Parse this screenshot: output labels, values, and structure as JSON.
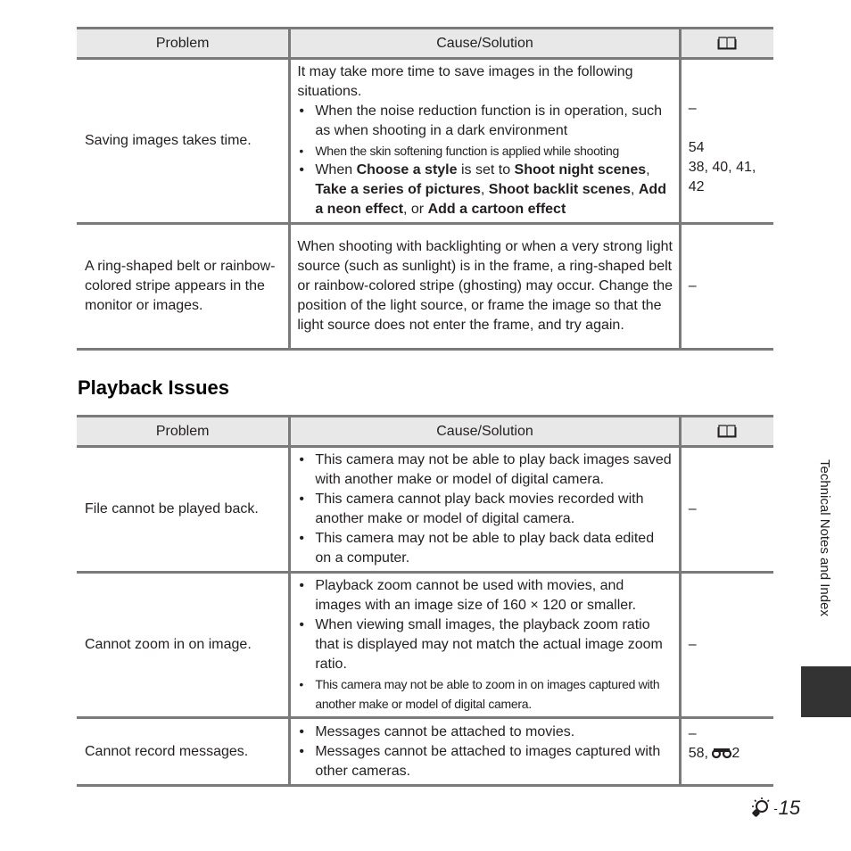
{
  "table1": {
    "headers": {
      "problem": "Problem",
      "cause": "Cause/Solution",
      "ref_icon": "book-icon"
    },
    "rows": [
      {
        "problem": "Saving images takes time.",
        "intro": "It may take more time to save images in the following situations.",
        "bullets": {
          "b1": "When the noise reduction function is in operation, such as when shooting in a dark environment",
          "b2": "When the skin softening function is applied while shooting",
          "b3": {
            "p1": "When ",
            "s1": "Choose a style",
            "p2": " is set to ",
            "s2": "Shoot night scenes",
            "p3": ", ",
            "s3": "Take a series of pictures",
            "p4": ", ",
            "s4": "Shoot backlit scenes",
            "p5": ", ",
            "s5": "Add a neon effect",
            "p6": ", or ",
            "s6": "Add a cartoon effect"
          }
        },
        "refs": {
          "r1": "–",
          "r2": "54",
          "r3": "38, 40, 41, 42"
        }
      },
      {
        "problem": "A ring-shaped belt or rainbow-colored stripe appears in the monitor or images.",
        "cause": "When shooting with backlighting or when a very strong light source (such as sunlight) is in the frame, a ring-shaped belt or rainbow-colored stripe (ghosting) may occur. Change the position of the light source, or frame the image so that the light source does not enter the frame, and try again.",
        "ref": "–"
      }
    ]
  },
  "section_title": "Playback Issues",
  "table2": {
    "headers": {
      "problem": "Problem",
      "cause": "Cause/Solution",
      "ref_icon": "book-icon"
    },
    "rows": [
      {
        "problem": "File cannot be played back.",
        "bullets": [
          "This camera may not be able to play back images saved with another make or model of digital camera.",
          "This camera cannot play back movies recorded with another make or model of digital camera.",
          "This camera may not be able to play back data edited on a computer."
        ],
        "ref": "–"
      },
      {
        "problem": "Cannot zoom in on image.",
        "bullets": [
          "Playback zoom cannot be used with movies, and images with an image size of 160 × 120 or smaller.",
          "When viewing small images, the playback zoom ratio that is displayed may not match the actual image zoom ratio.",
          "This camera may not be able to zoom in on images captured with another make or model of digital camera."
        ],
        "ref": "–"
      },
      {
        "problem": "Cannot record messages.",
        "bullets": [
          "Messages cannot be attached to movies.",
          "Messages cannot be attached to images captured with other cameras."
        ],
        "refs": {
          "r1": "–",
          "r2_prefix": "58, ",
          "r2_icon": "binoculars-icon",
          "r2_suffix": "2"
        }
      }
    ]
  },
  "side_tab": {
    "label": "Technical Notes and Index"
  },
  "footer": {
    "page_icon": "lightbulb-icon",
    "page_number": "15",
    "page_dash": "-"
  }
}
